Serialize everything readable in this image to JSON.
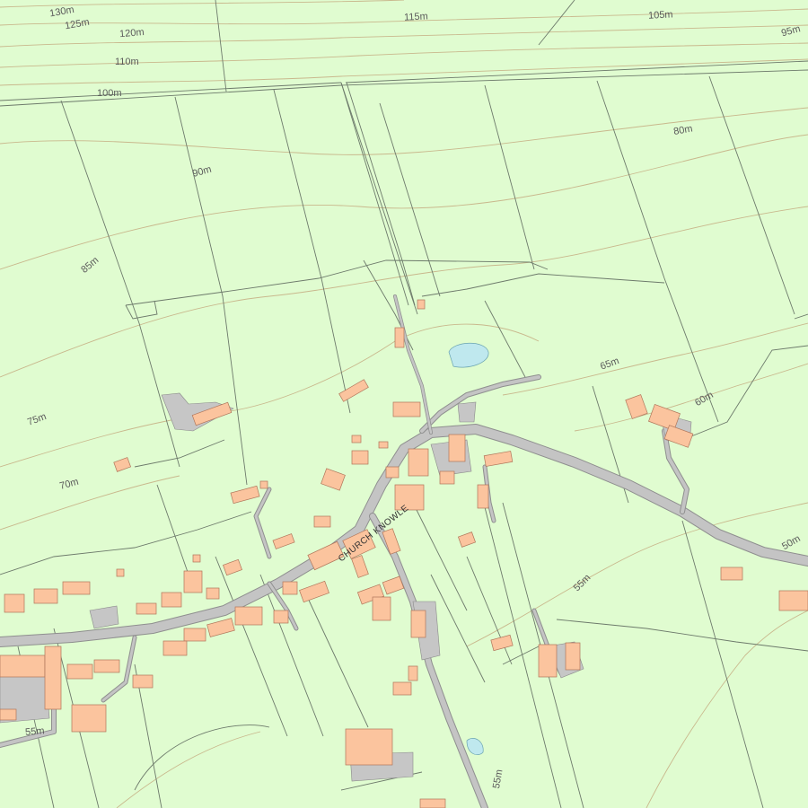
{
  "colors": {
    "land": "#e0fcd0",
    "contour": "#c9b88d",
    "field_boundary": "#6d7a6b",
    "road": "#c4c4c4",
    "building": "#fbc49e",
    "water": "#bfe8ee"
  },
  "map": {
    "road_name": "CHURCH KNOWLE",
    "contour_labels": [
      "130m",
      "125m",
      "120m",
      "115m",
      "110m",
      "105m",
      "100m",
      "95m",
      "90m",
      "85m",
      "80m",
      "75m",
      "70m",
      "65m",
      "60m",
      "55m",
      "55m",
      "50m",
      "55m"
    ]
  }
}
